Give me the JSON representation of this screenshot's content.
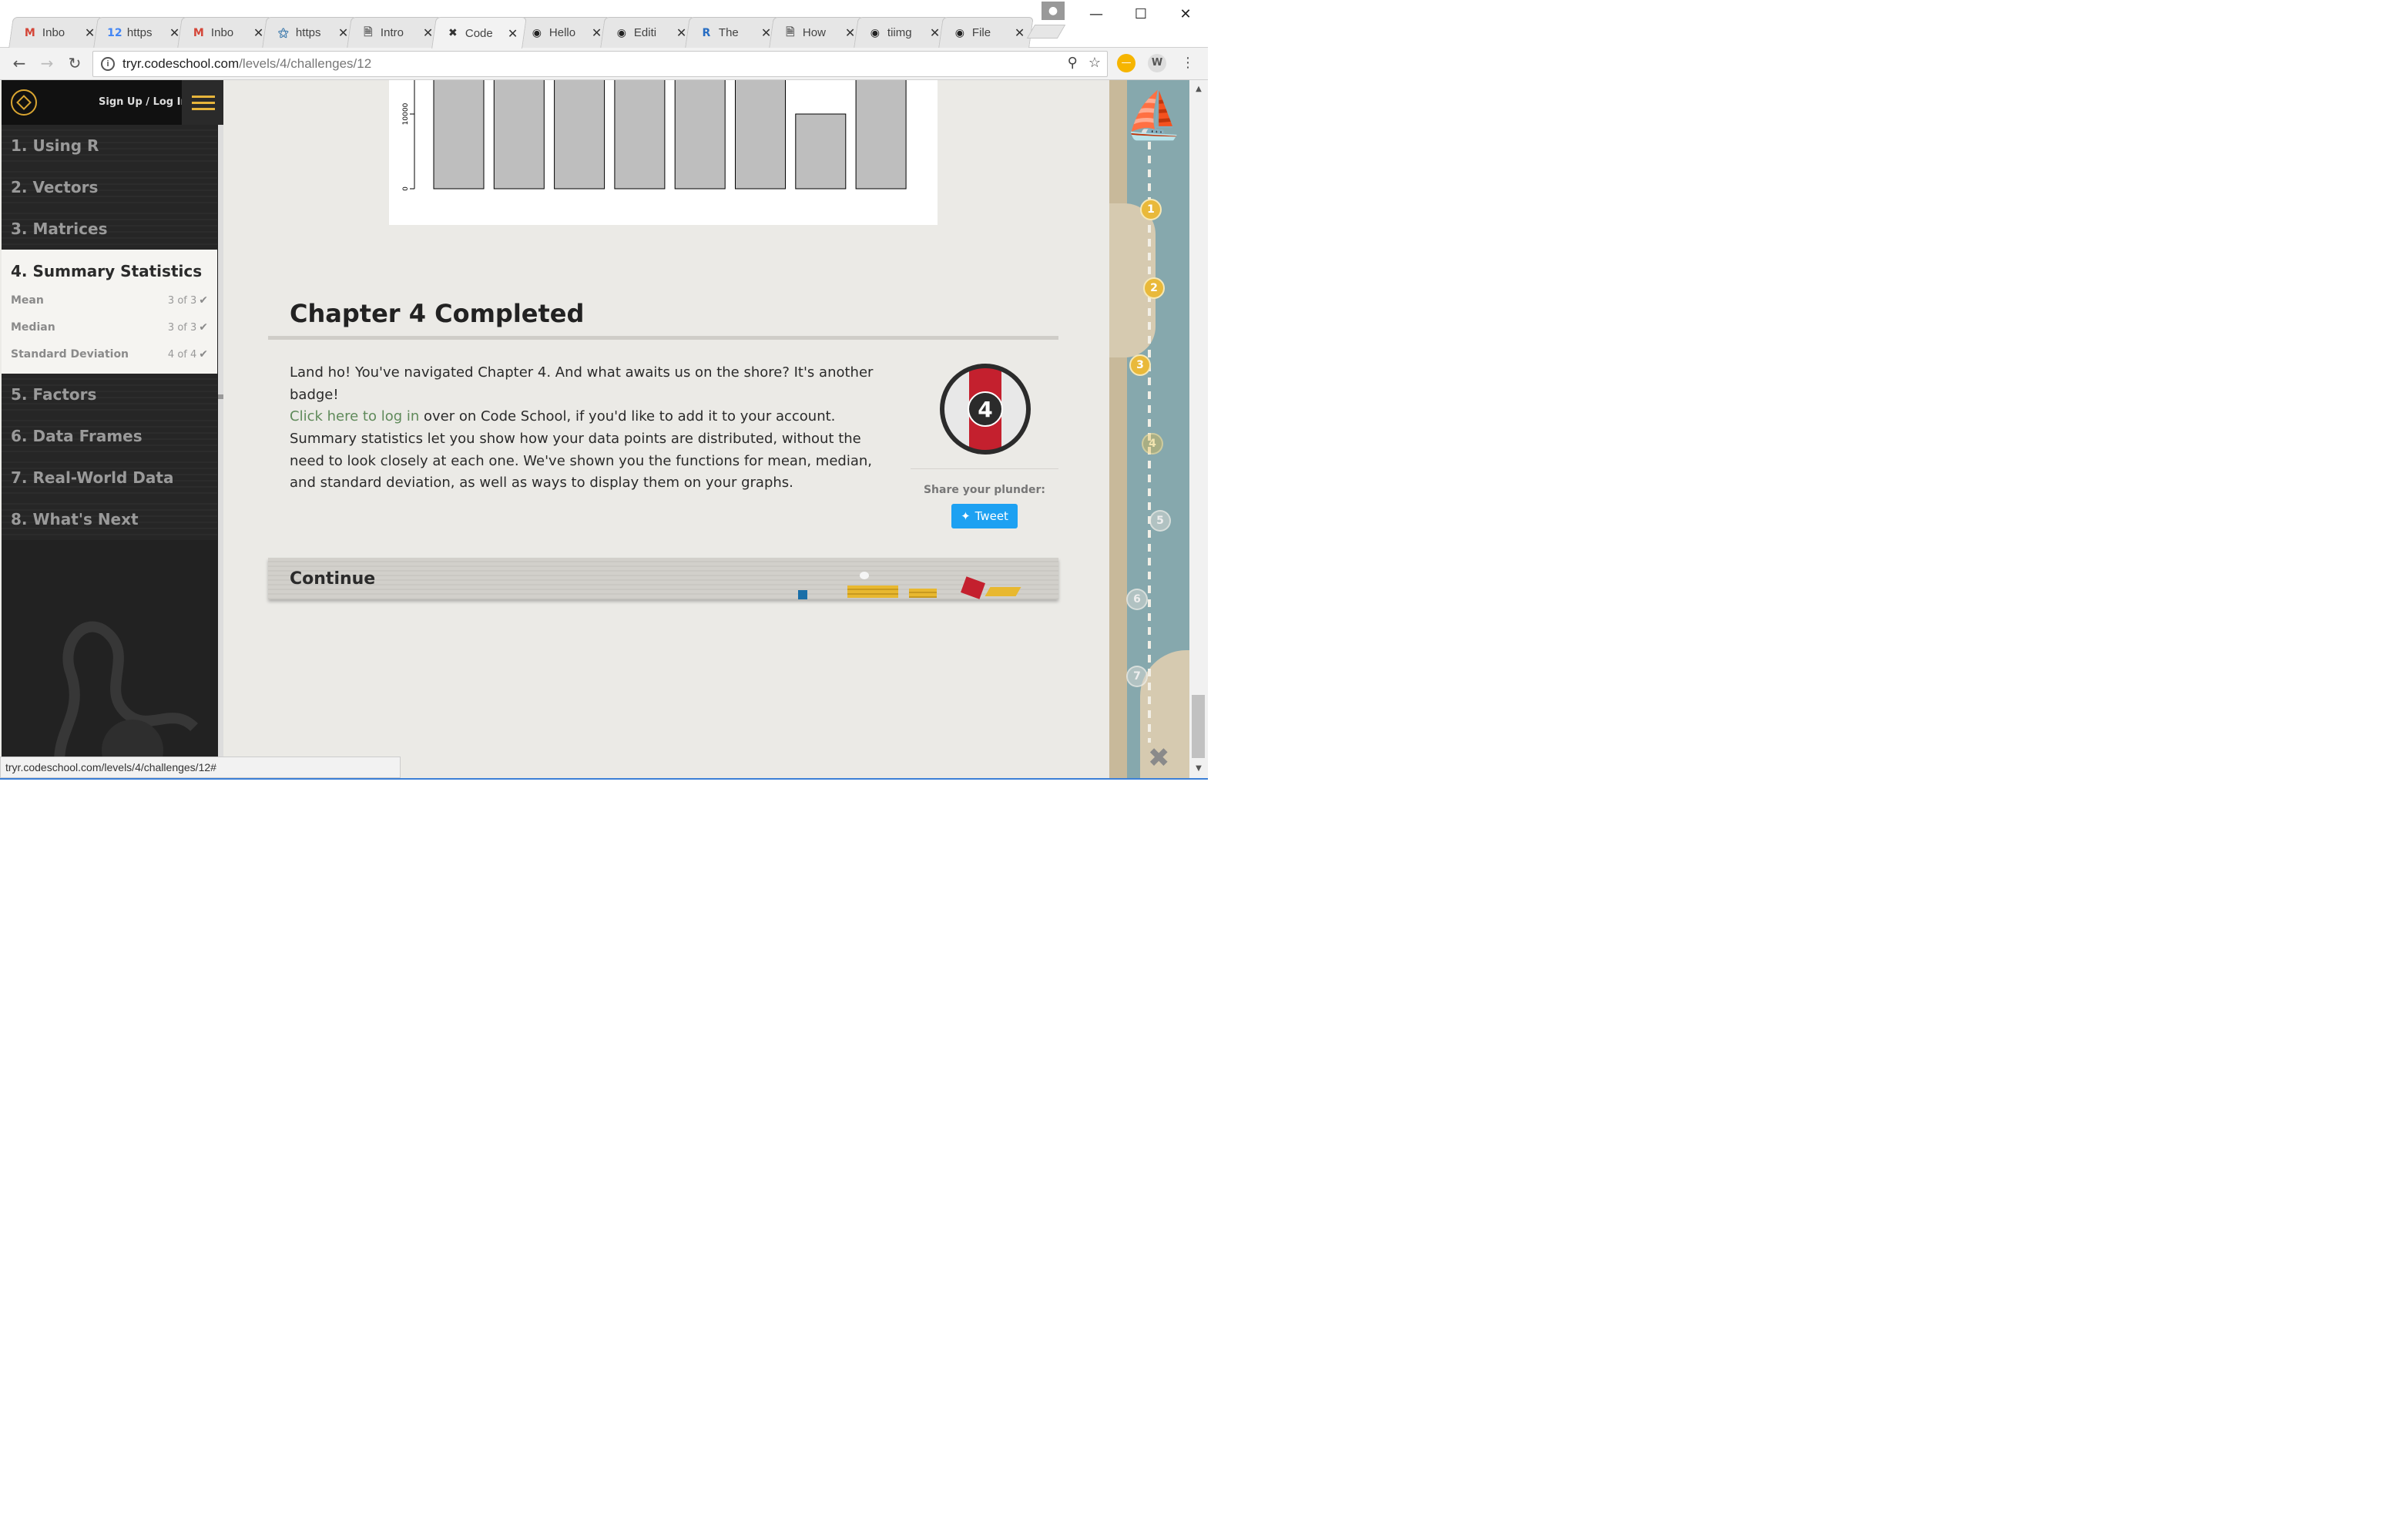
{
  "browser": {
    "tabs": [
      {
        "label": "Inbo",
        "icon": "gmail-icon"
      },
      {
        "label": "https",
        "icon": "calendar-icon"
      },
      {
        "label": "Inbo",
        "icon": "gmail-icon"
      },
      {
        "label": "https",
        "icon": "python-icon"
      },
      {
        "label": "Intro",
        "icon": "document-icon"
      },
      {
        "label": "Code",
        "icon": "codeschool-icon"
      },
      {
        "label": "Hello",
        "icon": "github-icon"
      },
      {
        "label": "Editi",
        "icon": "github-icon"
      },
      {
        "label": "The",
        "icon": "r-icon"
      },
      {
        "label": "How",
        "icon": "document-icon"
      },
      {
        "label": "tiimg",
        "icon": "github-icon"
      },
      {
        "label": "File",
        "icon": "github-icon"
      }
    ],
    "active_tab": 5,
    "url_host": "tryr.codeschool.com",
    "url_path": "/levels/4/challenges/12",
    "status_url": "tryr.codeschool.com/levels/4/challenges/12#",
    "extension_w": "W"
  },
  "sidebar": {
    "signup": "Sign Up / Log In",
    "chapters": [
      {
        "label": "1. Using R"
      },
      {
        "label": "2. Vectors"
      },
      {
        "label": "3. Matrices"
      },
      {
        "label": "4. Summary Statistics"
      },
      {
        "label": "5. Factors"
      },
      {
        "label": "6. Data Frames"
      },
      {
        "label": "7. Real-World Data"
      },
      {
        "label": "8. What's Next"
      }
    ],
    "subitems": [
      {
        "label": "Mean",
        "count": "3 of 3"
      },
      {
        "label": "Median",
        "count": "3 of 3"
      },
      {
        "label": "Standard Deviation",
        "count": "4 of 4"
      }
    ]
  },
  "chart_data": {
    "type": "bar",
    "ytick_labels": [
      "0",
      "10000"
    ],
    "values_relative": [
      1,
      1,
      1,
      1,
      1,
      1,
      0.5,
      1
    ],
    "note_values": "bars extend above visible area; 7th bar reaches 10000"
  },
  "main": {
    "title": "Chapter 4 Completed",
    "p1_text": "Land ho! You've navigated Chapter 4. And what awaits us on the shore? It's another badge!",
    "p1_link": "Click here to log in",
    "p1_rest": " over on Code School, if you'd like to add it to your account.",
    "p2": "Summary statistics let you show how your data points are distributed, without the need to look closely at each one. We've shown you the functions for mean, median, and standard deviation, as well as ways to display them on your graphs.",
    "badge_number": "4",
    "share_label": "Share your plunder:",
    "tweet_label": "Tweet",
    "continue_label": "Continue"
  },
  "map": {
    "waypoints": [
      "1",
      "2",
      "3",
      "4",
      "5",
      "6",
      "7"
    ]
  }
}
